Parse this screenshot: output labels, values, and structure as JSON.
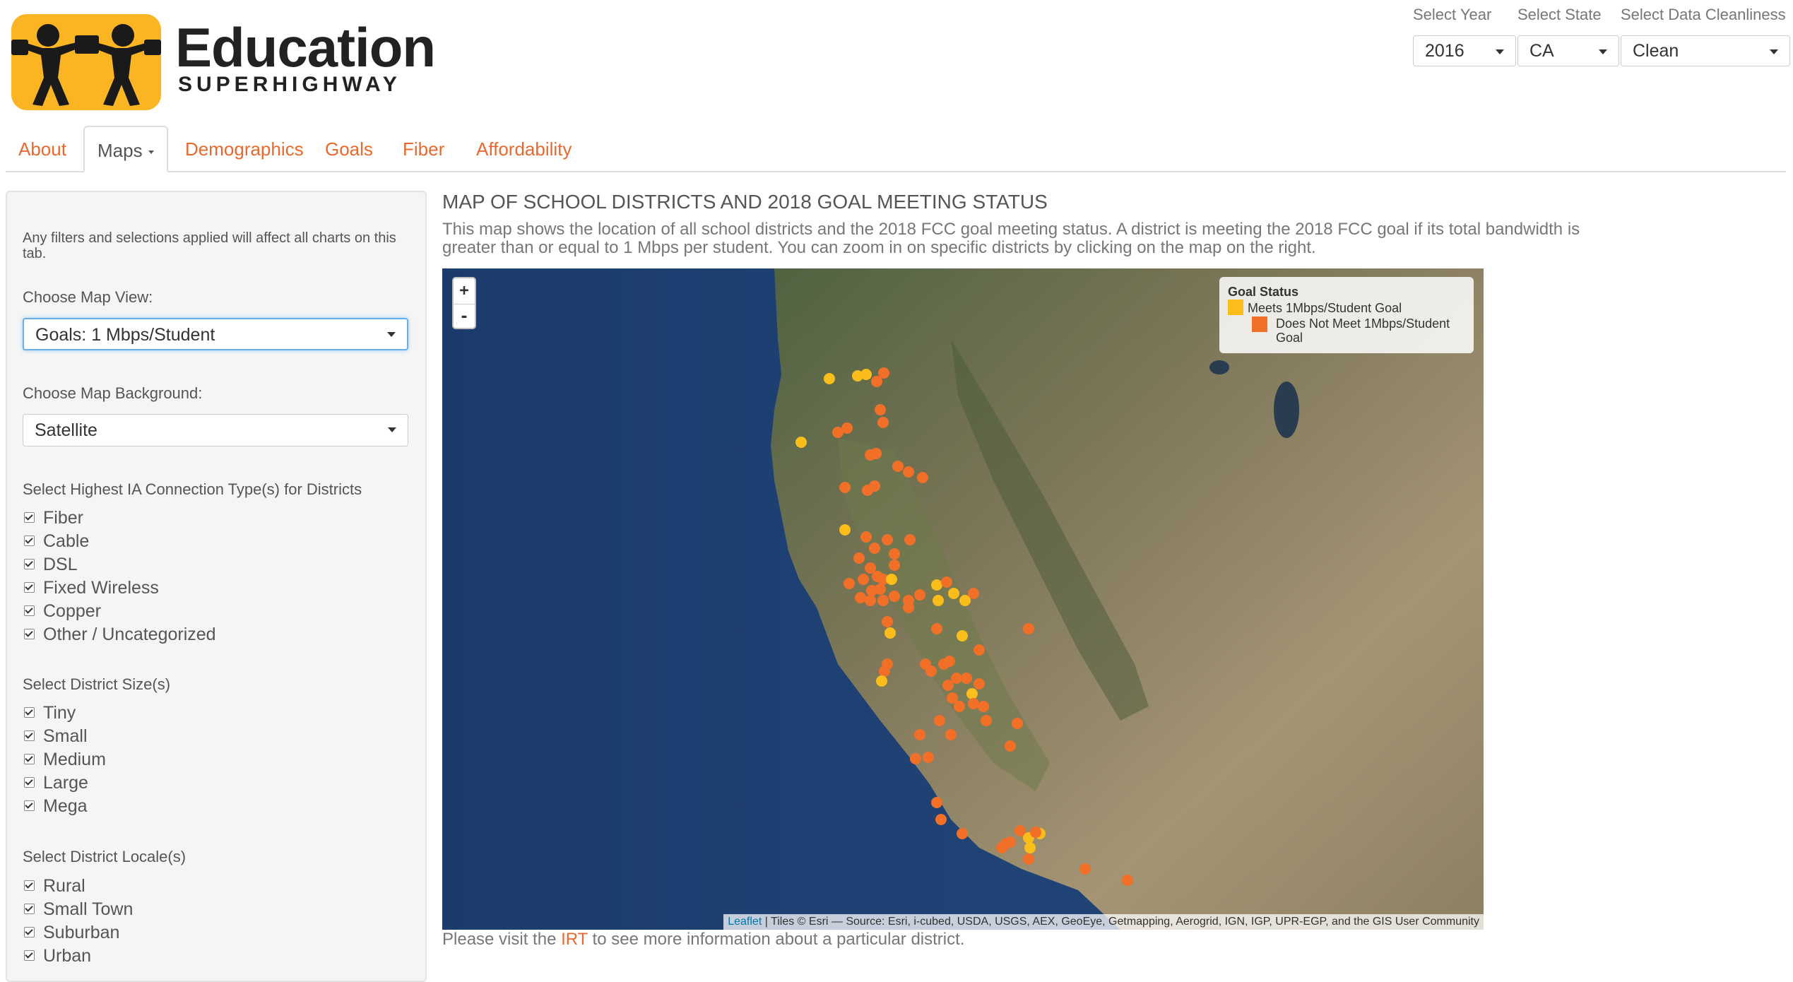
{
  "header": {
    "logo_title": "Education",
    "logo_subtitle": "SUPERHIGHWAY",
    "year_label": "Select Year",
    "year_value": "2016",
    "state_label": "Select State",
    "state_value": "CA",
    "cleanliness_label": "Select Data Cleanliness",
    "cleanliness_value": "Clean"
  },
  "tabs": [
    {
      "label": "About",
      "active": false
    },
    {
      "label": "Maps",
      "active": true,
      "dropdown": true
    },
    {
      "label": "Demographics",
      "active": false
    },
    {
      "label": "Goals",
      "active": false
    },
    {
      "label": "Fiber",
      "active": false
    },
    {
      "label": "Affordability",
      "active": false
    }
  ],
  "sidebar": {
    "note": "Any filters and selections applied will affect all charts on this tab.",
    "map_view_label": "Choose Map View:",
    "map_view_value": "Goals: 1 Mbps/Student",
    "background_label": "Choose Map Background:",
    "background_value": "Satellite",
    "connection_label": "Select Highest IA Connection Type(s) for Districts",
    "connection_types": [
      "Fiber",
      "Cable",
      "DSL",
      "Fixed Wireless",
      "Copper",
      "Other / Uncategorized"
    ],
    "size_label": "Select District Size(s)",
    "sizes": [
      "Tiny",
      "Small",
      "Medium",
      "Large",
      "Mega"
    ],
    "locale_label": "Select District Locale(s)",
    "locales": [
      "Rural",
      "Small Town",
      "Suburban",
      "Urban"
    ]
  },
  "main": {
    "title": "MAP OF SCHOOL DISTRICTS AND 2018 GOAL MEETING STATUS",
    "description": "This map shows the location of all school districts and the 2018 FCC goal meeting status. A district is meeting the 2018 FCC goal if its total bandwidth is greater than or equal to 1 Mbps per student. You can zoom in on specific districts by clicking on the map on the right.",
    "footer_before": "Please visit the ",
    "footer_link": "IRT",
    "footer_after": " to see more information about a particular district."
  },
  "map": {
    "zoom_in": "+",
    "zoom_out": "-",
    "legend_title": "Goal Status",
    "legend_meets": "Meets 1Mbps/Student Goal",
    "legend_not_meets": "Does Not Meet 1Mbps/Student Goal",
    "attribution_link": "Leaflet",
    "attribution_text": " | Tiles © Esri — Source: Esri, i-cubed, USDA, USGS, AEX, GeoEye, Getmapping, Aerogrid, IGN, IGP, UPR-EGP, and the GIS User Community",
    "colors": {
      "meets": "#fbbd1a",
      "not_meets": "#f26f28",
      "ocean": "#1f3f70",
      "land": "#8a8064"
    }
  },
  "colors": {
    "accent": "#e8692e",
    "logo_bg": "#fbb422"
  }
}
